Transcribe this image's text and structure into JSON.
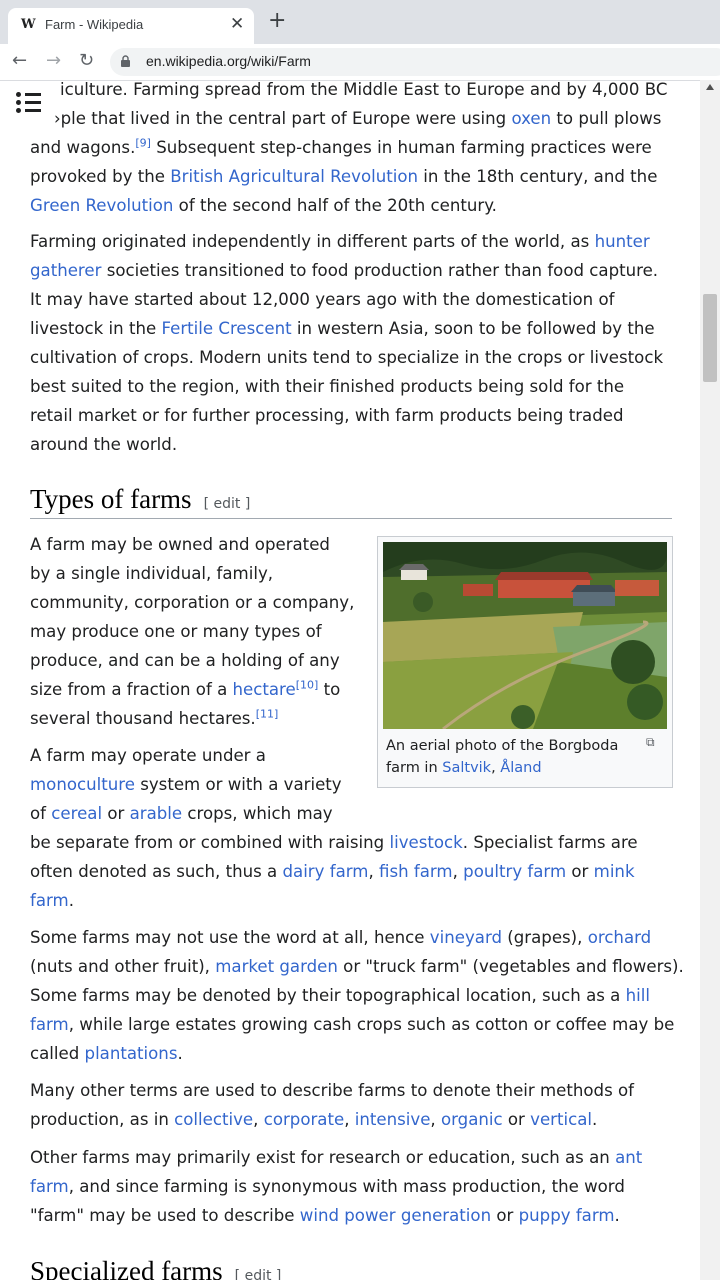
{
  "browser": {
    "tab_title": "Farm - Wikipedia",
    "tab_favicon": "W",
    "tab_close": "✕",
    "new_tab": "+",
    "back": "←",
    "forward": "→",
    "reload": "↻",
    "url": "en.wikipedia.org/wiki/Farm"
  },
  "article": {
    "p1": {
      "l1": "iculture. Farming spread from the Middle East to Europe and by 4,000 BC",
      "l2a": "›ple that lived in the central part of Europe were using ",
      "l2_link": "oxen",
      "l2b": " to pull plows",
      "l3a": "and wagons.",
      "l3_ref": "[9]",
      "l3b": " Subsequent step-changes in human farming practices were",
      "l4a": "provoked by the ",
      "l4_link": "British Agricultural Revolution",
      "l4b": " in the 18th century, and the",
      "l5_link": "Green Revolution",
      "l5b": " of the second half of the 20th century."
    },
    "p2": {
      "l1a": "Farming originated independently in different parts of the world, as ",
      "l1_link": "hunter",
      "l2_link": "gatherer",
      "l2b": " societies transitioned to food production rather than food capture.",
      "l3": "It may have started about 12,000 years ago with the domestication of",
      "l4a": "livestock in the ",
      "l4_link": "Fertile Crescent",
      "l4b": " in western Asia, soon to be followed by the",
      "l5": "cultivation of crops. Modern units tend to specialize in the crops or livestock",
      "l6": "best suited to the region, with their finished products being sold for the",
      "l7": "retail market or for further processing, with farm products being traded",
      "l8": "around the world."
    },
    "section1": {
      "title": "Types of farms",
      "edit": "[ edit ]"
    },
    "p3": {
      "l1": "A farm may be owned and operated",
      "l2": "by a single individual, family,",
      "l3": "community, corporation or a company,",
      "l4": "may produce one or many types of",
      "l5": "produce, and can be a holding of any",
      "l6a": "size from a fraction of a ",
      "l6_link": "hectare",
      "l6_ref": "[10]",
      "l6b": " to",
      "l7a": "several thousand hectares.",
      "l7_ref": "[11]"
    },
    "figure": {
      "caption_a": "An aerial photo of the Borgboda",
      "caption_b": "farm in ",
      "caption_link1": "Saltvik",
      "caption_sep": ", ",
      "caption_link2": "Åland",
      "magnify": "⧉"
    },
    "p4": {
      "l1": "A farm may operate under a",
      "l2_link": "monoculture",
      "l2b": " system or with a variety",
      "l3a": "of ",
      "l3_link1": "cereal",
      "l3b": " or ",
      "l3_link2": "arable",
      "l3c": " crops, which may",
      "l4a": "be separate from or combined with raising ",
      "l4_link": "livestock",
      "l4b": ". Specialist farms are",
      "l5a": "often denoted as such, thus a ",
      "l5_link1": "dairy farm",
      "l5_sep1": ", ",
      "l5_link2": "fish farm",
      "l5_sep2": ", ",
      "l5_link3": "poultry farm",
      "l5b": " or ",
      "l5_link4": "mink",
      "l6_link": "farm",
      "l6b": "."
    },
    "p5": {
      "l1a": "Some farms may not use the word at all, hence ",
      "l1_link1": "vineyard",
      "l1b": " (grapes), ",
      "l1_link2": "orchard",
      "l2a": "(nuts and other fruit), ",
      "l2_link": "market garden",
      "l2b": " or \"truck farm\" (vegetables and flowers).",
      "l3a": "Some farms may be denoted by their topographical location, such as a ",
      "l3_link": "hill",
      "l4_link": "farm",
      "l4b": ", while large estates growing cash crops such as cotton or coffee may be",
      "l5a": "called ",
      "l5_link": "plantations",
      "l5b": "."
    },
    "p6": {
      "l1": "Many other terms are used to describe farms to denote their methods of",
      "l2a": "production, as in ",
      "l2_link1": "collective",
      "l2_s1": ", ",
      "l2_link2": "corporate",
      "l2_s2": ", ",
      "l2_link3": "intensive",
      "l2_s3": ", ",
      "l2_link4": "organic",
      "l2b": " or ",
      "l2_link5": "vertical",
      "l2c": "."
    },
    "p7": {
      "l1a": "Other farms may primarily exist for research or education, such as an ",
      "l1_link": "ant",
      "l2_link": "farm",
      "l2b": ", and since farming is synonymous with mass production, the word",
      "l3a": "\"farm\" may be used to describe ",
      "l3_link1": "wind power generation",
      "l3b": " or ",
      "l3_link2": "puppy farm",
      "l3c": "."
    },
    "section2": {
      "title": "Specialized farms",
      "edit": "[ edit ]"
    }
  },
  "icons": {
    "menu": "menu-icon",
    "lock": "lock-icon",
    "magnify": "enlarge-icon"
  }
}
